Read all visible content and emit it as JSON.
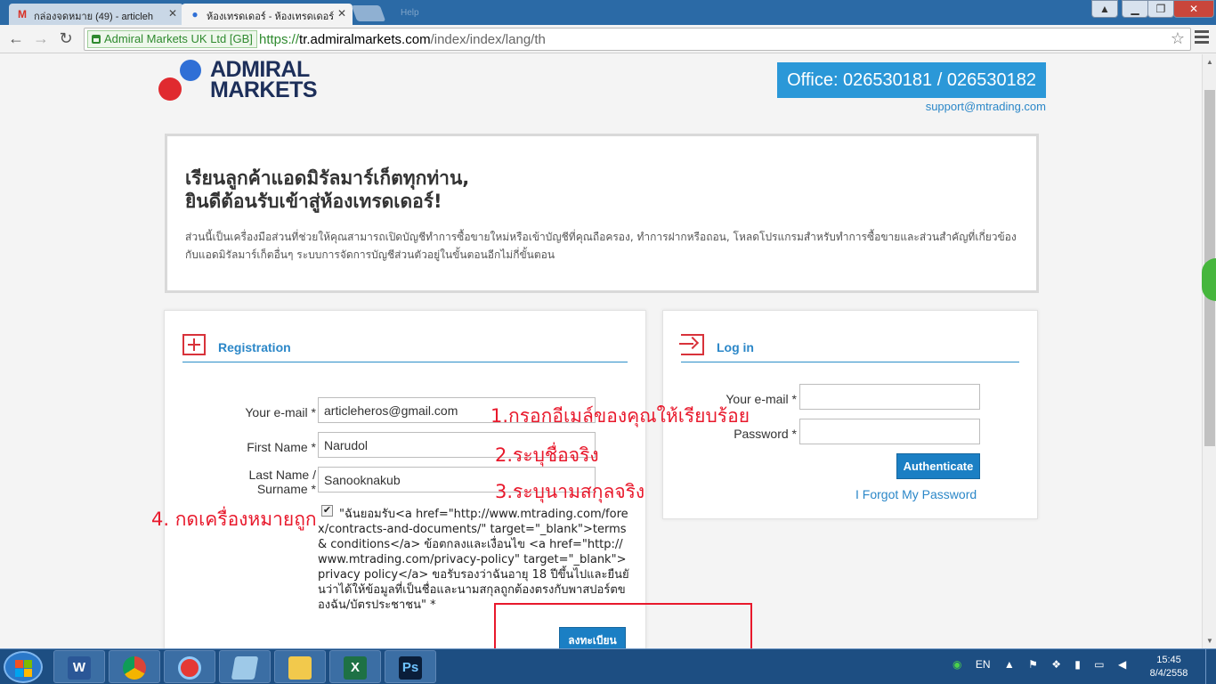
{
  "browser": {
    "tabs": [
      {
        "label": "กล่องจดหมาย (49) - articleh",
        "icon": "gmail-icon"
      },
      {
        "label": "ห้องเทรดเดอร์ - ห้องเทรดเดอร์",
        "icon": "admiral-icon"
      }
    ],
    "ghost_tab": "Help",
    "ev_label": "Admiral Markets UK Ltd [GB]",
    "url_proto": "https://",
    "url_host": "tr.admiralmarkets.com",
    "url_path": "/index/index/lang/th"
  },
  "header": {
    "brand": "ADMIRAL\nMARKETS",
    "office": "Office: 026530181 / 026530182",
    "support_email": "support@mtrading.com"
  },
  "welcome": {
    "title": "เรียนลูกค้าแอดมิรัลมาร์เก็ตทุกท่าน,\nยินดีต้อนรับเข้าสู่ห้องเทรดเดอร์!",
    "body": "ส่วนนี้เป็นเครื่องมือส่วนที่ช่วยให้คุณสามารถเปิดบัญชีทำการซื้อขายใหม่หรือเข้าบัญชีที่คุณถือครอง, ทำการฝากหรือถอน, โหลดโปรแกรมสำหรับทำการซื้อขายและส่วนสำคัญที่เกี่ยวข้องกับแอดมิรัลมาร์เก็ตอื่นๆ ระบบการจัดการบัญชีส่วนตัวอยู่ในขั้นตอนอีกไม่กี่ขั้นตอน"
  },
  "registration": {
    "title": "Registration",
    "email_label": "Your e-mail *",
    "email_value": "articleheros@gmail.com",
    "first_name_label": "First Name *",
    "first_name_value": "Narudol",
    "last_name_label": "Last Name /\nSurname *",
    "last_name_value": "Sanooknakub",
    "terms_text": "\"ฉันยอมรับ<a href=\"http://www.mtrading.com/forex/contracts-and-documents/\" target=\"_blank\">terms & conditions</a> ข้อตกลงและเงื่อนไข <a href=\"http://www.mtrading.com/privacy-policy\" target=\"_blank\">privacy policy</a> ขอรับรองว่าฉันอายุ 18 ปีขึ้นไปและยืนยันว่าได้ให้ข้อมูลที่เป็นชื่อและนามสกุลถูกต้องตรงกับพาสปอร์ตของฉัน/บัตรประชาชน\" *",
    "submit_label": "ลงทะเบียน",
    "checked": true
  },
  "login": {
    "title": "Log in",
    "email_label": "Your e-mail *",
    "password_label": "Password *",
    "auth_label": "Authenticate",
    "forgot_label": "I Forgot My Password"
  },
  "annotations": {
    "step1": "1.กรอกอีเมล์ของคุณให้เรียบร้อย",
    "step2": "2.ระบุชื่อจริง",
    "step3": "3.ระบุนามสกุลจริง",
    "step4": "4. กดเครื่องหมายถูก",
    "color": "#e8192c"
  },
  "taskbar": {
    "apps": [
      "W",
      "chrome",
      "browser",
      "notepad",
      "explorer",
      "X",
      "Ps"
    ],
    "lang": "EN",
    "time": "15:45",
    "date": "8/4/2558"
  }
}
